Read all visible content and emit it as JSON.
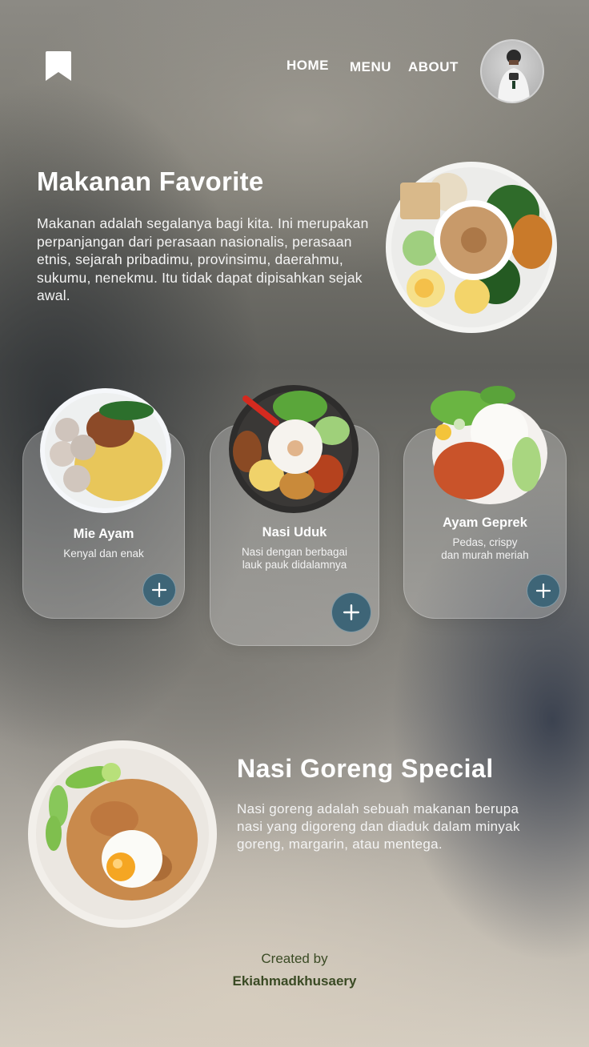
{
  "header": {
    "nav": [
      {
        "label": "HOME"
      },
      {
        "label": "MENU"
      },
      {
        "label": "ABOUT"
      }
    ]
  },
  "hero": {
    "title": "Makanan Favorite",
    "description": "Makanan adalah segalanya bagi kita. Ini merupakan perpanjangan dari perasaan nasionalis, perasaan etnis, sejarah pribadimu, provinsimu, daerahmu, sukumu, nenekmu. Itu tidak dapat dipisahkan sejak awal."
  },
  "cards": [
    {
      "title": "Mie Ayam",
      "subtitle": "Kenyal dan enak"
    },
    {
      "title": "Nasi Uduk",
      "subtitle": "Nasi dengan berbagai\nlauk pauk didalamnya"
    },
    {
      "title": "Ayam Geprek",
      "subtitle": "Pedas, crispy\ndan murah meriah"
    }
  ],
  "special": {
    "title": "Nasi Goreng Special",
    "description": "Nasi goreng adalah sebuah makanan berupa nasi yang digoreng dan diaduk dalam minyak goreng, margarin, atau mentega."
  },
  "footer": {
    "created_label": "Created by",
    "author": "Ekiahmadkhusaery"
  },
  "colors": {
    "accent": "#3e6577",
    "credit_text": "#3a4a24"
  }
}
